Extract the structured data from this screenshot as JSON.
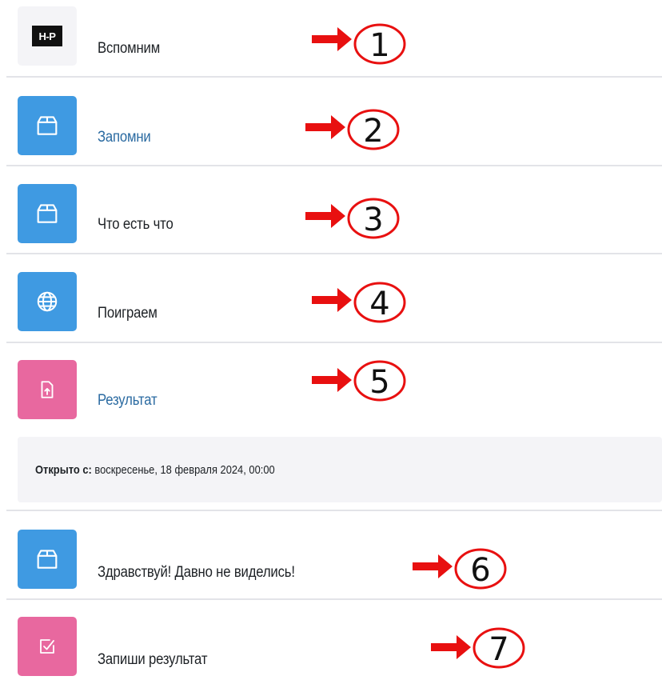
{
  "activities": [
    {
      "title": "Вспомним",
      "icon": "h5p-logo-icon",
      "logo_text": "H-P",
      "number": "1"
    },
    {
      "title": "Запомни",
      "icon": "package-icon",
      "number": "2"
    },
    {
      "title": "Что есть что",
      "icon": "package-icon",
      "number": "3"
    },
    {
      "title": "Поиграем",
      "icon": "globe-icon",
      "number": "4"
    },
    {
      "title": "Результат",
      "icon": "file-upload-icon",
      "number": "5"
    },
    {
      "title": "Здравствуй! Давно не виделись!",
      "icon": "package-icon",
      "number": "6"
    },
    {
      "title": "Запиши результат",
      "icon": "checkbox-edit-icon",
      "number": "7"
    }
  ],
  "restriction": {
    "label": "Открыто с:",
    "value": " воскресенье, 18 февраля 2024, 00:00"
  },
  "colors": {
    "blue_icon": "#3f9ae2",
    "pink_icon": "#e8689f",
    "link_text": "#2a6aa1",
    "annotation_red": "#e81010"
  }
}
